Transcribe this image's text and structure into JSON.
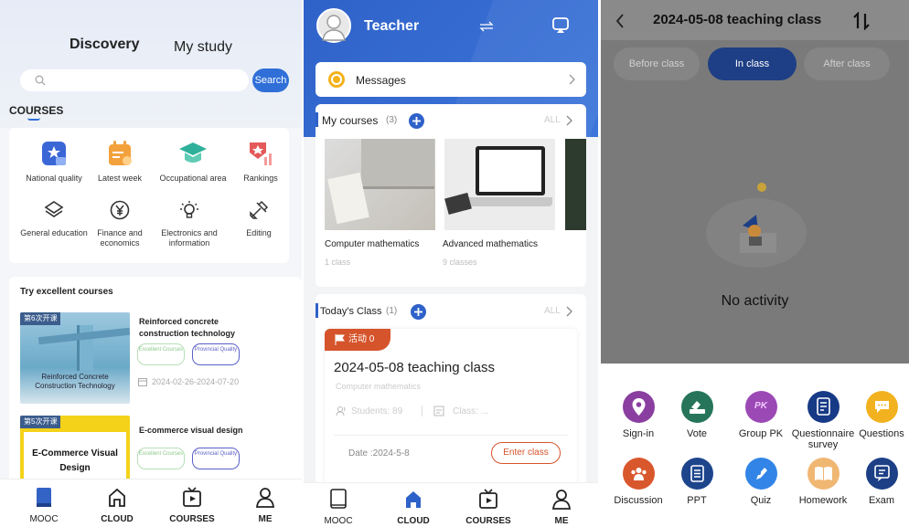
{
  "panel1": {
    "tabs": [
      "Discovery",
      "My study"
    ],
    "search_placeholder": "",
    "search_button": "Search",
    "section_title": "COURSES",
    "categories": [
      {
        "label": "National quality",
        "icon": "national-quality-icon",
        "color": "#3a66d6"
      },
      {
        "label": "Latest week",
        "icon": "calendar-icon",
        "color": "#f0a040"
      },
      {
        "label": "Occupational area",
        "icon": "graduation-cap-icon",
        "color": "#33b49a"
      },
      {
        "label": "Rankings",
        "icon": "rankings-icon",
        "color": "#e05555"
      },
      {
        "label": "General education",
        "icon": "layers-icon",
        "color": "#333333"
      },
      {
        "label": "Finance and economics",
        "icon": "yen-icon",
        "color": "#333333"
      },
      {
        "label": "Electronics and information",
        "icon": "bulb-icon",
        "color": "#333333"
      },
      {
        "label": "Editing",
        "icon": "tools-icon",
        "color": "#333333"
      }
    ],
    "try_title": "Try excellent courses",
    "courses": [
      {
        "badge": "第6次开课",
        "thumb_caption": "Reinforced Concrete Construction Technology",
        "name": "Reinforced concrete construction technology",
        "tags": [
          "Excellent Courses",
          "Provincial Quality"
        ],
        "date": "2024-02-26-2024-07-20"
      },
      {
        "badge": "第5次开课",
        "thumb_caption": "E-Commerce Visual Design",
        "name": "E-commerce visual design",
        "tags": [
          "Excellent Courses",
          "Provincial Quality"
        ]
      }
    ],
    "nav": [
      "MOOC",
      "CLOUD",
      "COURSES",
      "ME"
    ]
  },
  "panel2": {
    "header_title": "Teacher",
    "messages_label": "Messages",
    "my_courses_label": "My courses",
    "my_courses_count": "(3)",
    "all_label": "ALL",
    "courses": [
      {
        "name": "Computer mathematics",
        "classes": "1 class"
      },
      {
        "name": "Advanced mathematics",
        "classes": "9 classes"
      }
    ],
    "todays_class_label": "Today's Class",
    "todays_class_count": "(1)",
    "activity_badge": "活动 0",
    "class_title": "2024-05-08 teaching class",
    "class_course": "Computer mathematics",
    "students_label": "Students: 89",
    "class_label": "Class: ...",
    "date_label": "Date :2024-5-8",
    "enter_class": "Enter class",
    "nav": [
      "MOOC",
      "CLOUD",
      "COURSES",
      "ME"
    ]
  },
  "panel3": {
    "title": "2024-05-08 teaching class",
    "segments": [
      "Before class",
      "In class",
      "After class"
    ],
    "active_segment": "In class",
    "empty_label": "No activity",
    "tools": [
      {
        "label": "Sign-in",
        "icon": "location-pin-icon",
        "color": "#8a3fa0"
      },
      {
        "label": "Vote",
        "icon": "vote-icon",
        "color": "#26755a"
      },
      {
        "label": "Group PK",
        "icon": "group-pk-icon",
        "color": "#9b49b5"
      },
      {
        "label": "Questionnaire survey",
        "icon": "questionnaire-icon",
        "color": "#173a86"
      },
      {
        "label": "Questions",
        "icon": "chat-icon",
        "color": "#f2b21f"
      },
      {
        "label": "Discussion",
        "icon": "discussion-icon",
        "color": "#d9572c"
      },
      {
        "label": "PPT",
        "icon": "ppt-icon",
        "color": "#1d458c"
      },
      {
        "label": "Quiz",
        "icon": "quiz-icon",
        "color": "#3285e6"
      },
      {
        "label": "Homework",
        "icon": "book-icon",
        "color": "#f0b773"
      },
      {
        "label": "Exam",
        "icon": "exam-icon",
        "color": "#1d3f86"
      }
    ]
  }
}
